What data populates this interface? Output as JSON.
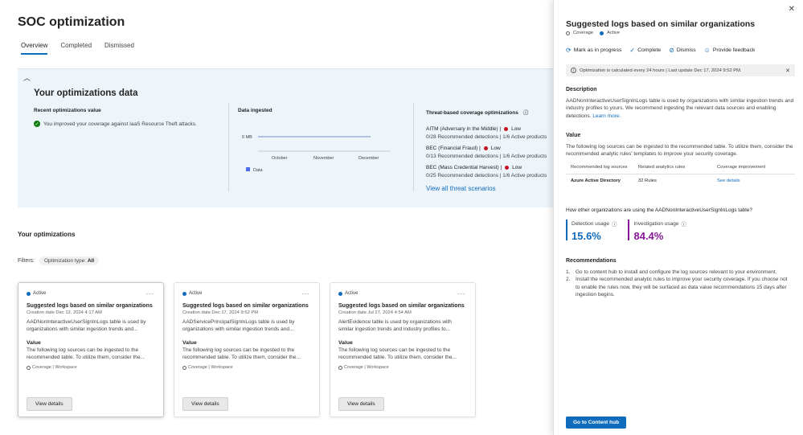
{
  "page": {
    "title": "SOC optimization",
    "tabs": [
      "Overview",
      "Completed",
      "Dismissed"
    ]
  },
  "summary": {
    "title": "Your optimizations data",
    "recent": {
      "heading": "Recent optimizations value",
      "message": "You improved your coverage against IaaS Resource Theft attacks."
    },
    "ingested": {
      "heading": "Data ingested",
      "y_tick": "0 MB",
      "x_ticks": [
        "October",
        "November",
        "December"
      ],
      "legend": "Data"
    },
    "threats": {
      "heading": "Threat-based coverage optimizations",
      "items": [
        {
          "name": "AITM (Adversary in the Middle) |",
          "level": "Low",
          "stats": "0/28 Recommended detections | 1/6 Active products"
        },
        {
          "name": "BEC (Financial Fraud) |",
          "level": "Low",
          "stats": "0/13 Recommended detections | 1/6 Active products"
        },
        {
          "name": "BEC (Mass Credential Harvest) |",
          "level": "Low",
          "stats": "0/25 Recommended detections | 1/6 Active products"
        }
      ],
      "view_all": "View all threat scenarios"
    }
  },
  "optimizations": {
    "heading": "Your optimizations",
    "filters_label": "Filters:",
    "filter_pill_label": "Optimization type:",
    "filter_pill_value": "All",
    "cards": [
      {
        "status": "Active",
        "title": "Suggested logs based on similar organizations",
        "date": "Creation date  Dec 12, 2024 4:17 AM",
        "desc": "AADNonInteractiveUserSignInLogs table is used by organizations with similar ingestion trends and...",
        "value_heading": "Value",
        "value": "The following log sources can be ingested to the recommended table. To utilize them, consider the...",
        "tags": "Coverage | Workspace",
        "button": "View details"
      },
      {
        "status": "Active",
        "title": "Suggested logs based on similar organizations",
        "date": "Creation date  Dec 17, 2024 9:52 PM",
        "desc": "AADServicePrincipalSignInLogs table is used by organizations with similar ingestion trends and...",
        "value_heading": "Value",
        "value": "The following log sources can be ingested to the recommended table. To utilize them, consider the...",
        "tags": "Coverage | Workspace",
        "button": "View details"
      },
      {
        "status": "Active",
        "title": "Suggested logs based on similar organizations",
        "date": "Creation date  Jul 27, 2024 4:54 AM",
        "desc": "AlertEvidence table is used by organizations with similar ingestion trends and industry profiles to...",
        "value_heading": "Value",
        "value": "The following log sources can be ingested to the recommended table. To utilize them, consider the...",
        "tags": "Coverage | Workspace",
        "button": "View details"
      }
    ]
  },
  "panel": {
    "title": "Suggested logs based on similar organizations",
    "tag_coverage": "Coverage",
    "tag_status": "Active",
    "actions": {
      "mark": "Mark as in progress",
      "complete": "Complete",
      "dismiss": "Dismiss",
      "feedback": "Provide feedback"
    },
    "info": "Optimization is calculated every 24 hours | Last update Dec 17, 2024 9:52 PM.",
    "description_heading": "Description",
    "description": "AADNonInteractiveUserSignInLogs table is used by organizations with similar ingestion trends and industry profiles to yours. We recommend ingesting the relevant data sources and enabling detections.",
    "learn_more": "Learn more.",
    "value_heading": "Value",
    "value_text": "The following log sources can be ingested to the recommended table. To utilize them, consider the recommended analytic rules' templates to improve your security coverage.",
    "table": {
      "headers": [
        "Recommended log sources",
        "Related analytics rules",
        "Coverage improvement"
      ],
      "row": [
        "Azure Active Directory",
        "32 Rules",
        "See details"
      ]
    },
    "usage_heading": "How other organizations are using the AADNonInteractiveUserSignInLogs table?",
    "detection_label": "Detection usage",
    "detection_value": "15.6%",
    "investigation_label": "Investigation usage",
    "investigation_value": "84.4%",
    "recommendations_heading": "Recommendations",
    "recommendations": [
      "Go to content hub to install and configure the log sources relevant to your environment.",
      "Install the recommended analytic rules to improve your security coverage. If you choose not to enable the rules now, they will be surfaced as data value recommendations 15 days after ingestion begins."
    ],
    "primary_button": "Go to Content hub"
  },
  "colors": {
    "accent": "#0f6cbd",
    "risk_low": "#c50f1f",
    "success": "#107c10",
    "investigation": "#881798"
  }
}
